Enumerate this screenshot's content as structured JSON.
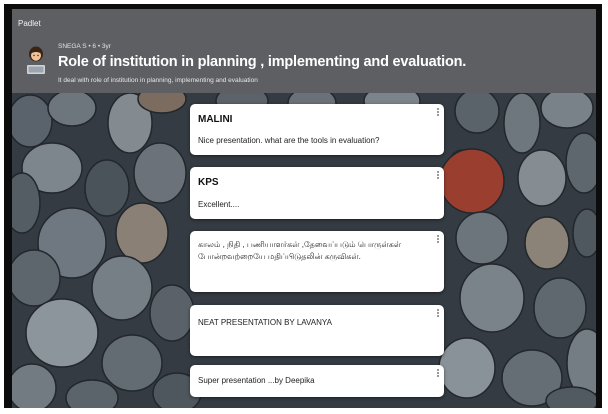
{
  "app": {
    "brand": "Padlet"
  },
  "board": {
    "meta": "SNEGA S  •  6  •  3yr",
    "title": "Role of institution in planning , implementing and evaluation.",
    "description": "It deal with role of institution in planning, implementing and evaluation"
  },
  "posts": [
    {
      "author": "MALINI",
      "body": "Nice presentation.  what are the tools in evaluation?"
    },
    {
      "author": "KPS",
      "body": "Excellent...."
    },
    {
      "author": "",
      "body": "காலம் , நிதி , பணியாளர்கள் ,தேவைப்படும் பொருள்கள் போன்றவற்றையே மதிப்பிடுதலின் கருவிகள்."
    },
    {
      "author": "",
      "body": "NEAT PRESENTATION BY LAVANYA"
    },
    {
      "author": "",
      "body": "Super presentation ...by Deepika"
    }
  ],
  "icons": {
    "avatar": "girl-with-laptop-avatar-icon",
    "post_menu": "more-vertical-icon"
  },
  "colors": {
    "header": "#5d5f63",
    "card": "#ffffff",
    "accent_rock": "#9a3f2f"
  }
}
